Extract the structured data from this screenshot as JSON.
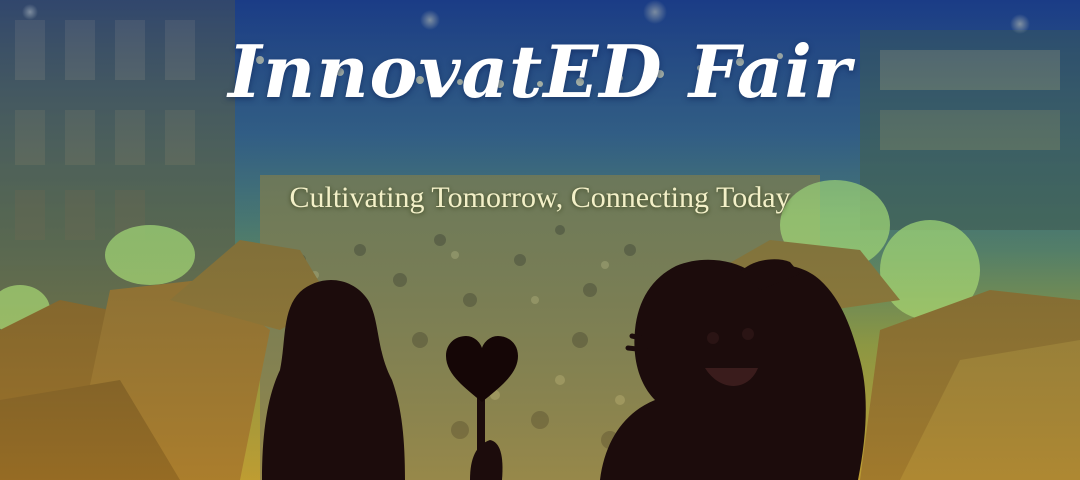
{
  "banner": {
    "title": "InnovatED Fair",
    "subtitle": "Cultivating Tomorrow, Connecting Today"
  },
  "colors": {
    "sky": "#1f3f86",
    "overlay_mid": "#4f7d6a",
    "overlay_bottom": "#b89a2e",
    "tent": "#8a5a1c",
    "tree_lights": "#b7f07a",
    "silhouette": "#1c0c0c",
    "title_text": "#ffffff",
    "subtitle_text": "#f3f0c8"
  },
  "icons": {
    "heart": "heart-icon",
    "surprise_marks": "surprise-lines-icon"
  }
}
